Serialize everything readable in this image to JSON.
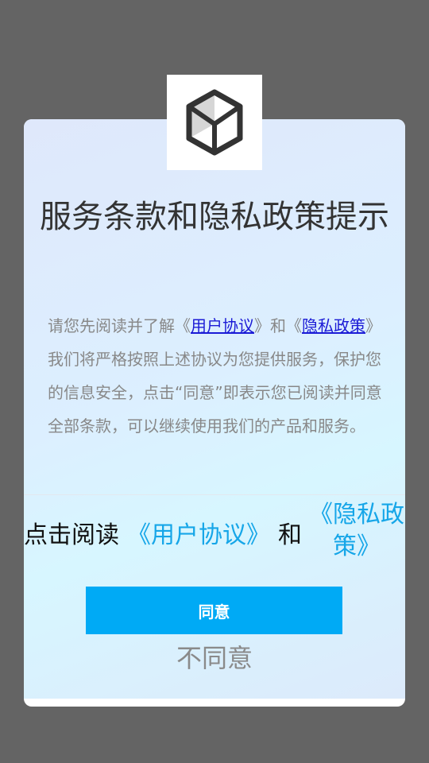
{
  "dialog": {
    "title": "服务条款和隐私政策提示",
    "body": {
      "part1": "请您先阅读并了解《",
      "user_link": "用户协议",
      "part2": "》和《",
      "privacy_link": "隐私政策",
      "part3": "》我们将严格按照上述协议为您提供服务，保护您的信息安全，点击“同意”即表示您已阅读并同意全部条款，可以继续使用我们的产品和服务。"
    },
    "bottom_line": {
      "prefix": "点击阅读",
      "user_agreement": "《用户协议》",
      "and": "和",
      "privacy_policy": "《隐私政策》"
    },
    "agree_label": "同意",
    "disagree_label": "不同意"
  },
  "logo": {
    "icon": "cube-icon"
  },
  "colors": {
    "backdrop": "#646464",
    "accent": "#00aaf5",
    "link_blue": "#16a6e8"
  }
}
